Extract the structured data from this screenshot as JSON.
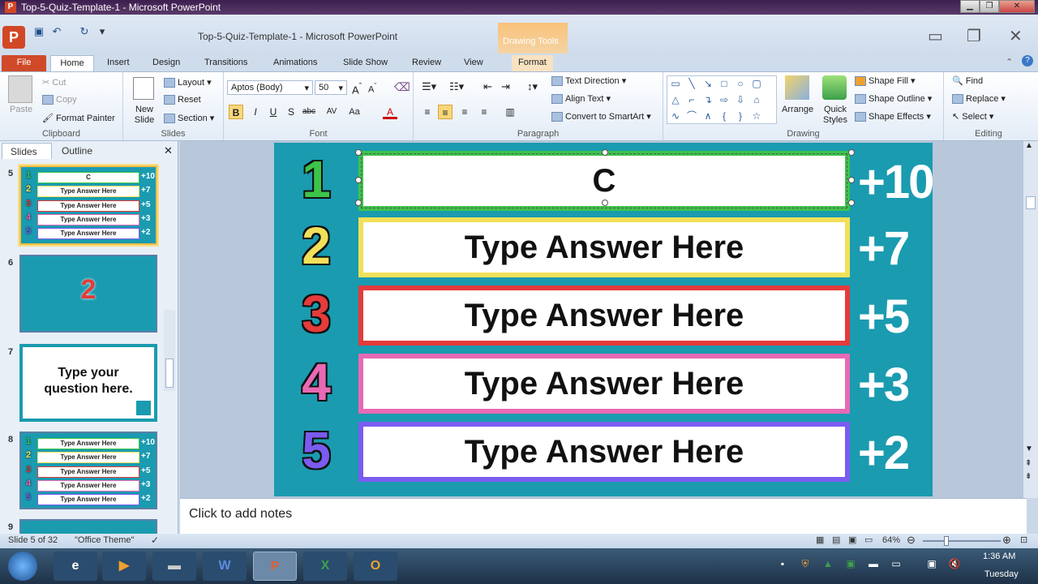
{
  "window": {
    "title": "Top-5-Quiz-Template-1 - Microsoft PowerPoint",
    "app_letter": "P"
  },
  "qat": {
    "doc_title": "Top-5-Quiz-Template-1  -  Microsoft PowerPoint",
    "context_group": "Drawing Tools",
    "save_icon": "save-icon",
    "undo_icon": "undo-icon",
    "redo_icon": "redo-icon"
  },
  "tabs": [
    "File",
    "Home",
    "Insert",
    "Design",
    "Transitions",
    "Animations",
    "Slide Show",
    "Review",
    "View",
    "Format"
  ],
  "ribbon": {
    "clipboard": {
      "paste": "Paste",
      "cut": "Cut",
      "copy": "Copy",
      "format_painter": "Format Painter",
      "name": "Clipboard"
    },
    "slides": {
      "new_slide": "New Slide",
      "layout": "Layout",
      "reset": "Reset",
      "section": "Section",
      "name": "Slides"
    },
    "font": {
      "family": "Aptos (Body)",
      "size": "50",
      "name": "Font"
    },
    "paragraph": {
      "text_direction": "Text Direction",
      "align_text": "Align Text",
      "convert_smartart": "Convert to SmartArt",
      "name": "Paragraph"
    },
    "drawing": {
      "arrange": "Arrange",
      "quick_styles": "Quick Styles",
      "shape_fill": "Shape Fill",
      "shape_outline": "Shape Outline",
      "shape_effects": "Shape Effects",
      "name": "Drawing"
    },
    "editing": {
      "find": "Find",
      "replace": "Replace",
      "select": "Select",
      "name": "Editing"
    }
  },
  "left_pane": {
    "tab_slides": "Slides",
    "tab_outline": "Outline",
    "thumbs": [
      {
        "num": "5",
        "rows": [
          {
            "n": "1",
            "t": "C",
            "p": "+10"
          },
          {
            "n": "2",
            "t": "Type Answer Here",
            "p": "+7"
          },
          {
            "n": "3",
            "t": "Type Answer Here",
            "p": "+5"
          },
          {
            "n": "4",
            "t": "Type Answer Here",
            "p": "+3"
          },
          {
            "n": "5",
            "t": "Type Answer Here",
            "p": "+2"
          }
        ]
      },
      {
        "num": "6",
        "big": "2"
      },
      {
        "num": "7",
        "question": "Type your question here."
      },
      {
        "num": "8",
        "rows": [
          {
            "n": "1",
            "t": "Type Answer Here",
            "p": "+10"
          },
          {
            "n": "2",
            "t": "Type Answer Here",
            "p": "+7"
          },
          {
            "n": "3",
            "t": "Type Answer Here",
            "p": "+5"
          },
          {
            "n": "4",
            "t": "Type Answer Here",
            "p": "+3"
          },
          {
            "n": "5",
            "t": "Type Answer Here",
            "p": "+2"
          }
        ]
      },
      {
        "num": "9"
      }
    ]
  },
  "slide": {
    "rows": [
      {
        "num": "1",
        "answer": "C",
        "points": "+10",
        "color": "#3cc44a"
      },
      {
        "num": "2",
        "answer": "Type Answer Here",
        "points": "+7",
        "color": "#f2e05a"
      },
      {
        "num": "3",
        "answer": "Type Answer Here",
        "points": "+5",
        "color": "#e53b3b"
      },
      {
        "num": "4",
        "answer": "Type Answer Here",
        "points": "+3",
        "color": "#e86ab4"
      },
      {
        "num": "5",
        "answer": "Type Answer Here",
        "points": "+2",
        "color": "#7a5cf0"
      }
    ],
    "background": "#1a9bb0"
  },
  "notes": {
    "placeholder": "Click to add notes"
  },
  "status": {
    "slide_info": "Slide 5 of 32",
    "theme": "\"Office Theme\"",
    "zoom": "64%"
  },
  "taskbar": {
    "time": "1:36 AM",
    "day": "Tuesday"
  }
}
